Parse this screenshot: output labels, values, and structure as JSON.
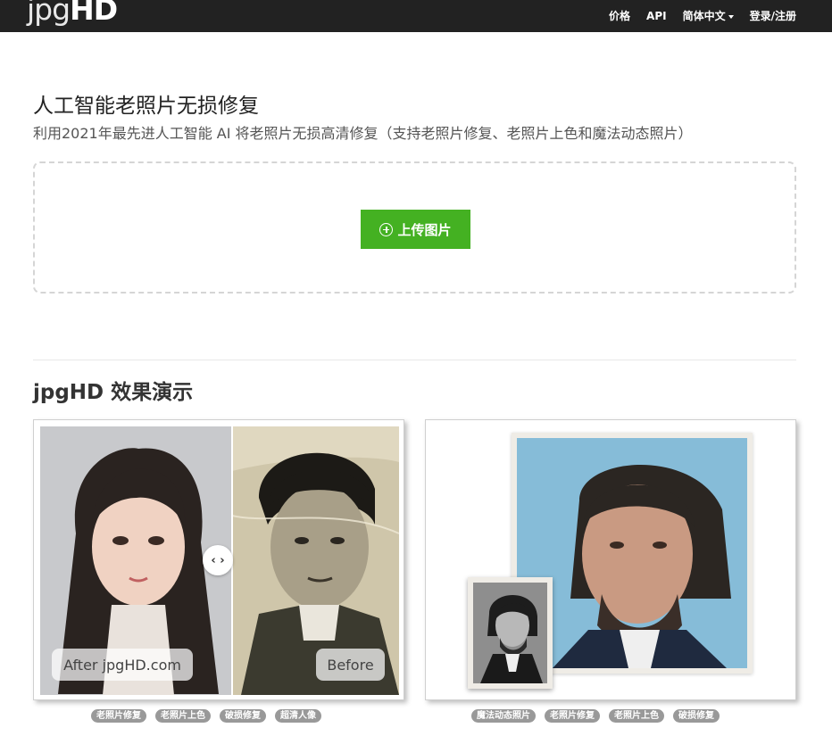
{
  "brand": {
    "logo_part1": "jpg",
    "logo_part2": "HD"
  },
  "nav": {
    "pricing": "价格",
    "api": "API",
    "language": "简体中文",
    "login": "登录/注册"
  },
  "hero": {
    "title": "人工智能老照片无损修复",
    "subtitle": "利用2021年最先进人工智能 AI 将老照片无损高清修复（支持老照片修复、老照片上色和魔法动态照片）"
  },
  "upload": {
    "button_label": "上传图片"
  },
  "demo": {
    "section_title": "jpgHD 效果演示",
    "left": {
      "after_label": "After jpgHD.com",
      "before_label": "Before",
      "handle_glyph": "‹ ›",
      "tags": [
        "老照片修复",
        "老照片上色",
        "破损修复",
        "超清人像"
      ]
    },
    "right": {
      "tags": [
        "魔法动态照片",
        "老照片修复",
        "老照片上色",
        "破损修复"
      ]
    }
  },
  "colors": {
    "navbar_bg": "#222222",
    "accent_green": "#44b122",
    "tag_bg": "#999999"
  },
  "icons": {
    "upload_button_icon": "plus-circle-icon",
    "compare_handle_icon": "chevrons-left-right-icon"
  }
}
